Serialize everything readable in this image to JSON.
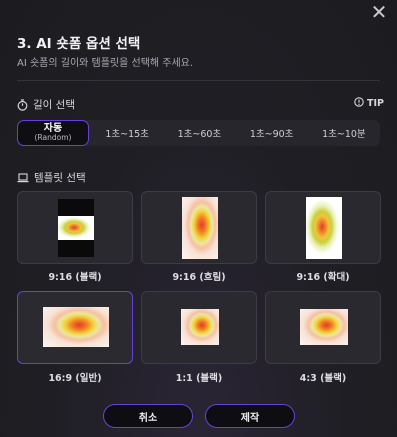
{
  "header": {
    "title": "3. AI 숏폼 옵션 선택",
    "subtitle": "AI 숏폼의 길이와 템플릿을 선택해 주세요.",
    "close_symbol": "✕"
  },
  "length": {
    "label": "길이 선택",
    "tip_label": "TIP",
    "options": [
      {
        "main": "자동",
        "sub": "(Random)",
        "selected": true
      },
      {
        "main": "1초~15초"
      },
      {
        "main": "1초~60초"
      },
      {
        "main": "1초~90초"
      },
      {
        "main": "1초~10분"
      }
    ]
  },
  "template": {
    "label": "템플릿 선택",
    "cards": [
      {
        "label": "9:16 (블랙)"
      },
      {
        "label": "9:16 (흐림)"
      },
      {
        "label": "9:16 (확대)"
      },
      {
        "label": "16:9 (일반)",
        "selected": true
      },
      {
        "label": "1:1 (블랙)"
      },
      {
        "label": "4:3 (블랙)"
      }
    ]
  },
  "footer": {
    "cancel_label": "취소",
    "confirm_label": "제작"
  },
  "colors": {
    "accent": "#6a42d1",
    "background": "#1c1c20",
    "card": "#2a292f"
  },
  "icons": {
    "close": "close-icon",
    "length": "stopwatch-icon",
    "tip": "info-icon",
    "template": "laptop-icon"
  }
}
